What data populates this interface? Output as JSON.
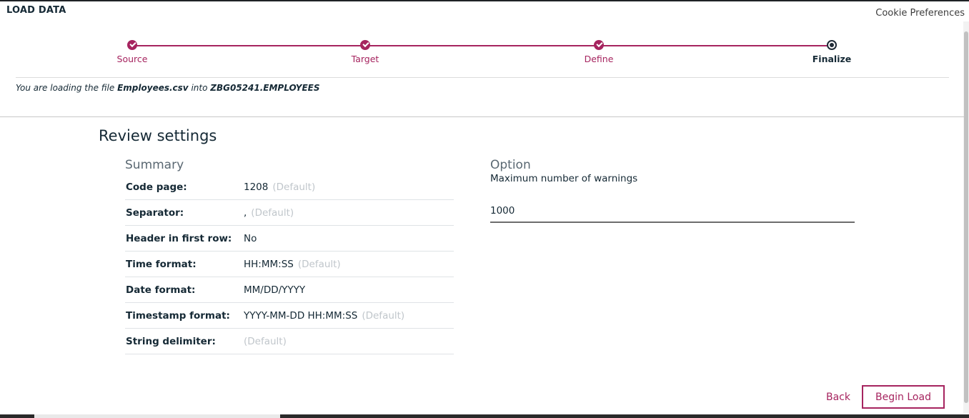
{
  "app": {
    "title": "LOAD DATA",
    "cookie_link": "Cookie Preferences"
  },
  "progress": {
    "steps": [
      {
        "label": "Source",
        "state": "complete"
      },
      {
        "label": "Target",
        "state": "complete"
      },
      {
        "label": "Define",
        "state": "complete"
      },
      {
        "label": "Finalize",
        "state": "current"
      }
    ]
  },
  "info": {
    "prefix": "You are loading the file",
    "file": "Employees.csv",
    "middle": "into",
    "target": "ZBG05241.EMPLOYEES"
  },
  "review": {
    "title": "Review settings",
    "summary_title": "Summary",
    "rows": [
      {
        "label": "Code page:",
        "value": "1208",
        "note": "(Default)"
      },
      {
        "label": "Separator:",
        "value": ",",
        "note": "(Default)"
      },
      {
        "label": "Header in first row:",
        "value": "No",
        "note": ""
      },
      {
        "label": "Time format:",
        "value": "HH:MM:SS",
        "note": "(Default)"
      },
      {
        "label": "Date format:",
        "value": "MM/DD/YYYY",
        "note": ""
      },
      {
        "label": "Timestamp format:",
        "value": "YYYY-MM-DD HH:MM:SS",
        "note": "(Default)"
      },
      {
        "label": "String delimiter:",
        "value": "",
        "note": "(Default)"
      }
    ]
  },
  "option": {
    "title": "Option",
    "label": "Maximum number of warnings",
    "value": "1000"
  },
  "actions": {
    "back": "Back",
    "begin": "Begin Load"
  },
  "colors": {
    "accent": "#a6245f",
    "text": "#152935",
    "muted": "#c0c6cb"
  }
}
